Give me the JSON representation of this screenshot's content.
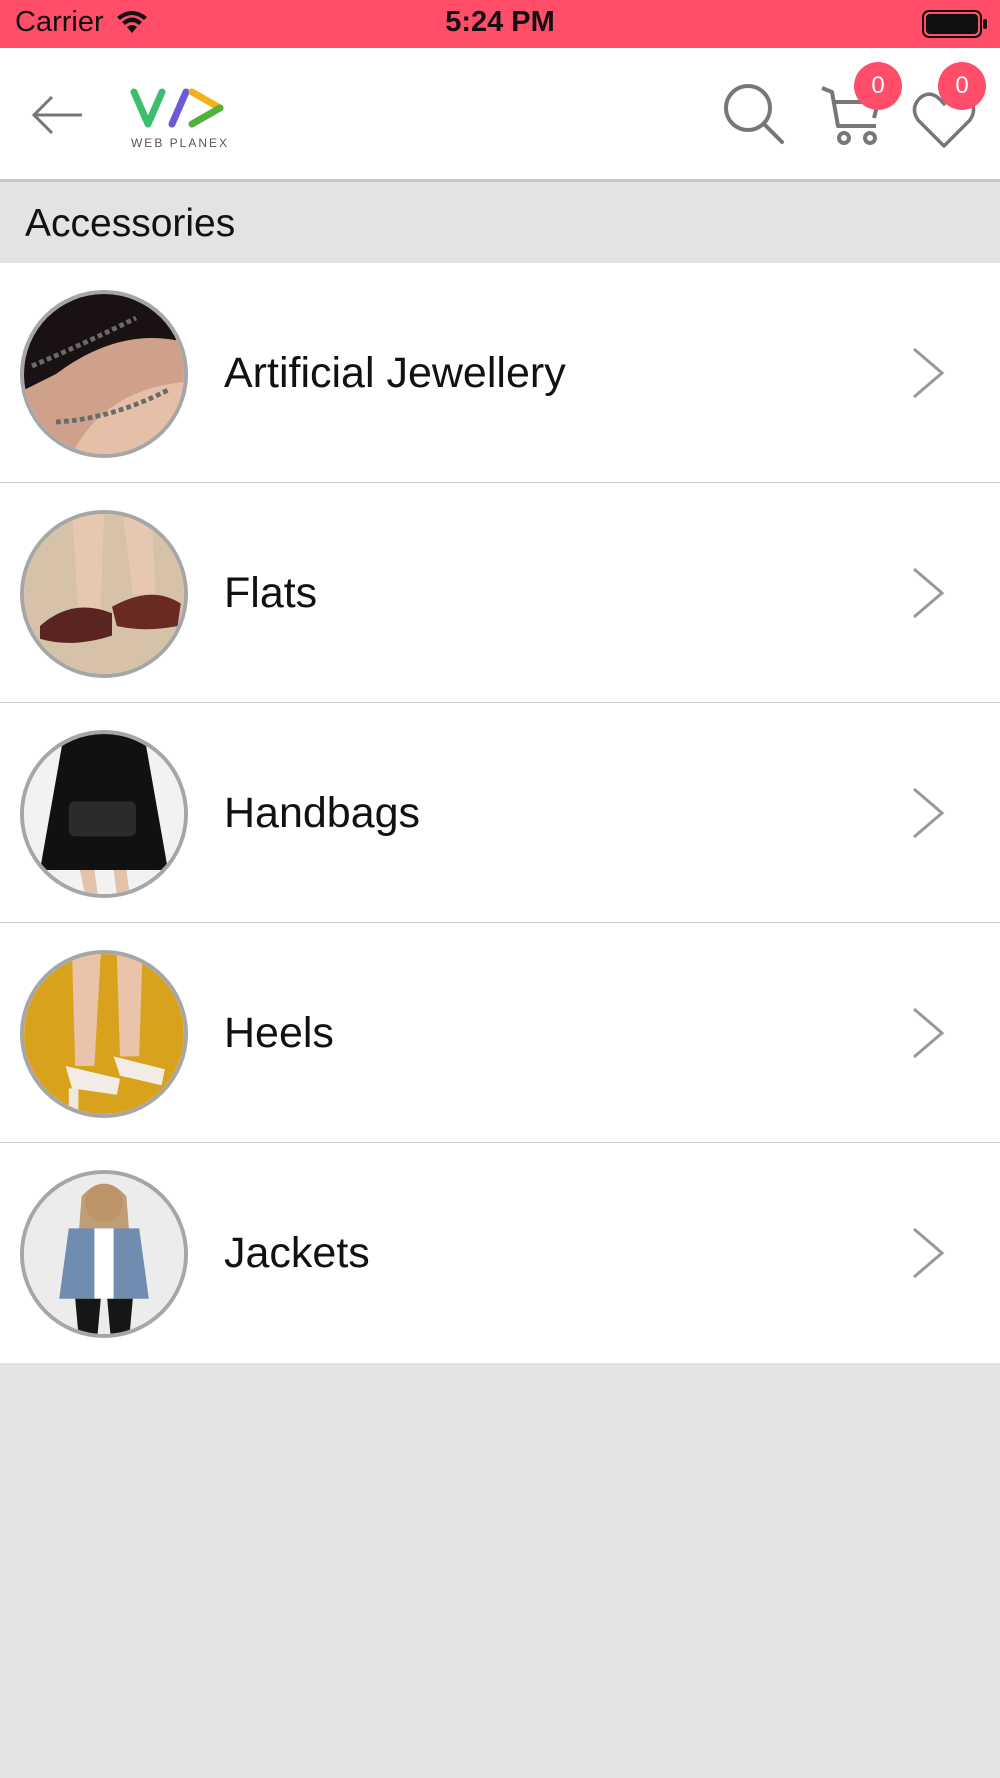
{
  "status_bar": {
    "carrier": "Carrier",
    "time": "5:24 PM"
  },
  "header": {
    "logo_text": "WEB PLANEX",
    "cart_count": "0",
    "wishlist_count": "0"
  },
  "section": {
    "title": "Accessories"
  },
  "categories": [
    {
      "label": "Artificial Jewellery"
    },
    {
      "label": "Flats"
    },
    {
      "label": "Handbags"
    },
    {
      "label": "Heels"
    },
    {
      "label": "Jackets"
    }
  ],
  "colors": {
    "accent": "#ff4d6a",
    "background": "#e3e3e3"
  }
}
